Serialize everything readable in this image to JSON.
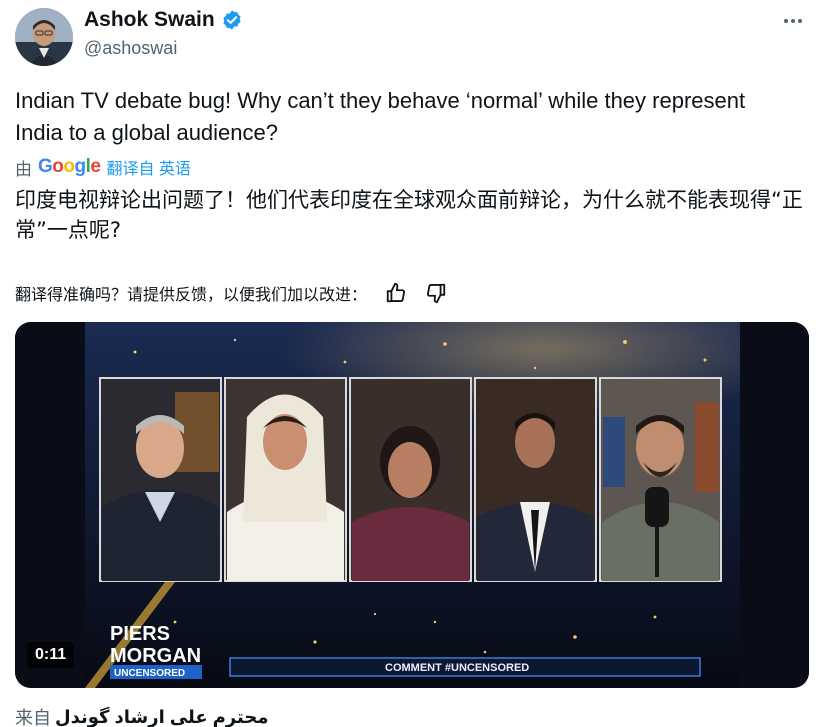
{
  "author": {
    "name": "Ashok Swain",
    "handle": "@ashoswai"
  },
  "tweet": {
    "text": "Indian TV debate bug! Why can’t they behave ‘normal’ while they represent India to a global audience?"
  },
  "translation": {
    "by_prefix": "由",
    "provider": "Google",
    "by_suffix": "翻译自 英语",
    "text": "印度电视辩论出问题了！他们代表印度在全球观众面前辩论，为什么就不能表现得“正常”一点呢?",
    "feedback_prompt": "翻译得准确吗？请提供反馈，以便我们加以改进："
  },
  "media": {
    "duration": "0:11",
    "show_logo_line1": "PIERS",
    "show_logo_line2": "MORGAN",
    "show_logo_line3": "UNCENSORED",
    "ticker_text": "COMMENT #UNCENSORED"
  },
  "source": {
    "prefix": "来自",
    "name": "محترم علی ارشاد گوندل"
  },
  "colors": {
    "accent": "#1d9bf0",
    "secondary_text": "#536471",
    "text": "#0f1419"
  },
  "icons": [
    "more-icon",
    "verified-badge-icon",
    "thumbs-up-icon",
    "thumbs-down-icon"
  ]
}
